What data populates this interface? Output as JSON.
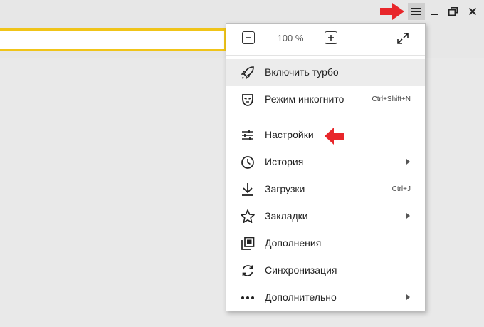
{
  "window": {
    "controls": [
      "menu-icon",
      "minimize-icon",
      "restore-icon",
      "close-icon"
    ],
    "accent_color": "#f0c419",
    "arrow_color": "#e8262a"
  },
  "menu": {
    "zoom": {
      "value": "100 %",
      "minus_icon": "zoom-out-icon",
      "plus_icon": "zoom-in-icon",
      "fullscreen_icon": "fullscreen-icon"
    },
    "items": [
      {
        "label": "Включить турбо",
        "icon": "rocket-icon",
        "shortcut": "",
        "submenu": false,
        "highlighted": true
      },
      {
        "label": "Режим инкогнито",
        "icon": "incognito-mask-icon",
        "shortcut": "Ctrl+Shift+N",
        "submenu": false
      },
      {
        "label": "Настройки",
        "icon": "settings-sliders-icon",
        "shortcut": "",
        "submenu": false
      },
      {
        "label": "История",
        "icon": "clock-icon",
        "shortcut": "",
        "submenu": true
      },
      {
        "label": "Загрузки",
        "icon": "download-icon",
        "shortcut": "Ctrl+J",
        "submenu": false
      },
      {
        "label": "Закладки",
        "icon": "star-icon",
        "shortcut": "",
        "submenu": true
      },
      {
        "label": "Дополнения",
        "icon": "extensions-icon",
        "shortcut": "",
        "submenu": false
      },
      {
        "label": "Синхронизация",
        "icon": "sync-icon",
        "shortcut": "",
        "submenu": false
      },
      {
        "label": "Дополнительно",
        "icon": "more-dots-icon",
        "shortcut": "",
        "submenu": true
      }
    ]
  }
}
